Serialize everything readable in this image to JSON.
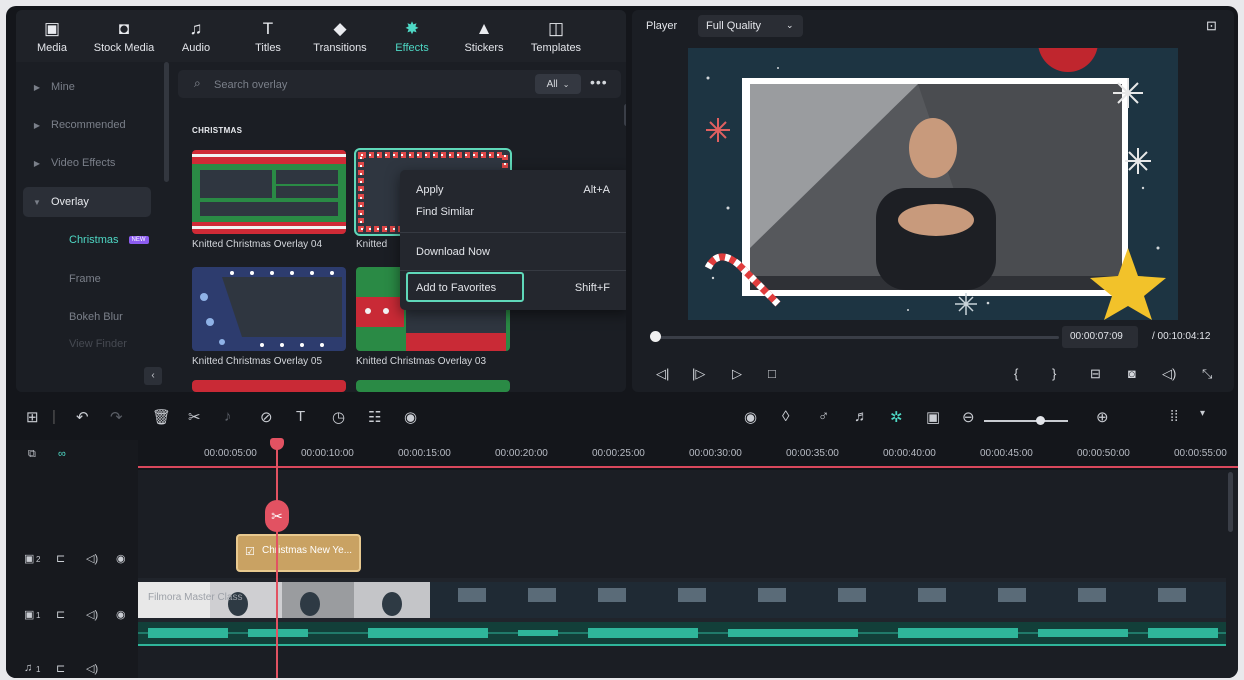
{
  "toolbar": {
    "tabs": [
      {
        "label": "Media",
        "icon": "media-icon"
      },
      {
        "label": "Stock Media",
        "icon": "stock-media-icon"
      },
      {
        "label": "Audio",
        "icon": "audio-icon"
      },
      {
        "label": "Titles",
        "icon": "titles-icon"
      },
      {
        "label": "Transitions",
        "icon": "transitions-icon"
      },
      {
        "label": "Effects",
        "icon": "effects-icon",
        "active": true
      },
      {
        "label": "Stickers",
        "icon": "stickers-icon"
      },
      {
        "label": "Templates",
        "icon": "templates-icon"
      }
    ]
  },
  "sidebar": {
    "items": [
      {
        "label": "Mine"
      },
      {
        "label": "Recommended"
      },
      {
        "label": "Video Effects"
      },
      {
        "label": "Overlay",
        "selected": true
      }
    ],
    "sub_items": [
      {
        "label": "Christmas",
        "badge": "NEW",
        "active": true
      },
      {
        "label": "Frame"
      },
      {
        "label": "Bokeh Blur"
      },
      {
        "label": "View Finder"
      }
    ]
  },
  "search": {
    "placeholder": "Search overlay",
    "filter": "All",
    "more": "•••"
  },
  "section_title": "CHRISTMAS",
  "thumbnails": [
    {
      "label": "Knitted Christmas Overlay 04"
    },
    {
      "label": "Knitted"
    },
    {
      "label": "Knitted Christmas Overlay 05"
    },
    {
      "label": "Knitted Christmas Overlay 03"
    }
  ],
  "context_menu": {
    "items": [
      {
        "label": "Apply",
        "shortcut": "Alt+A"
      },
      {
        "label": "Find Similar",
        "shortcut": ""
      },
      {
        "label": "Download Now",
        "shortcut": ""
      },
      {
        "label": "Add to Favorites",
        "shortcut": "Shift+F",
        "highlighted": true
      }
    ]
  },
  "player": {
    "label": "Player",
    "quality": "Full Quality",
    "current_time": "00:00:07:09",
    "total_time": "/ 00:10:04:12",
    "progress_fraction": 0.012
  },
  "timeline": {
    "ruler": [
      "00:00:05:00",
      "00:00:10:00",
      "00:00:15:00",
      "00:00:20:00",
      "00:00:25:00",
      "00:00:30:00",
      "00:00:35:00",
      "00:00:40:00",
      "00:00:45:00",
      "00:00:50:00",
      "00:00:55:00"
    ],
    "overlay_clip": "Christmas New Ye...",
    "video_clip_title": "Filmora Master Class",
    "tracks": [
      {
        "number": "2"
      },
      {
        "number": "1"
      },
      {
        "number": "1"
      }
    ]
  },
  "colors": {
    "accent": "#4ed8c5",
    "playhead": "#e25262",
    "overlay_clip": "#c9a263",
    "audio": "#2fb59a"
  }
}
